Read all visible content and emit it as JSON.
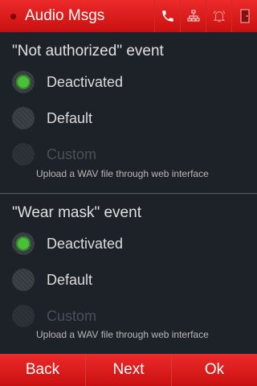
{
  "header": {
    "title": "Audio Msgs",
    "icons": [
      "phone-icon",
      "network-icon",
      "bell-icon",
      "door-icon"
    ]
  },
  "sections": [
    {
      "title": "\"Not authorized\" event",
      "options": [
        {
          "label": "Deactivated",
          "checked": true,
          "disabled": false
        },
        {
          "label": "Default",
          "checked": false,
          "disabled": false
        },
        {
          "label": "Custom",
          "checked": false,
          "disabled": true
        }
      ],
      "hint": "Upload a WAV file through web interface"
    },
    {
      "title": "\"Wear mask\" event",
      "options": [
        {
          "label": "Deactivated",
          "checked": true,
          "disabled": false
        },
        {
          "label": "Default",
          "checked": false,
          "disabled": false
        },
        {
          "label": "Custom",
          "checked": false,
          "disabled": true
        }
      ],
      "hint": "Upload a WAV file through web interface"
    }
  ],
  "footer": {
    "back_label": "Back",
    "next_label": "Next",
    "ok_label": "Ok"
  },
  "colors": {
    "accent": "#d81818",
    "background": "#1d2228",
    "radio_checked": "#4cbf3a"
  }
}
